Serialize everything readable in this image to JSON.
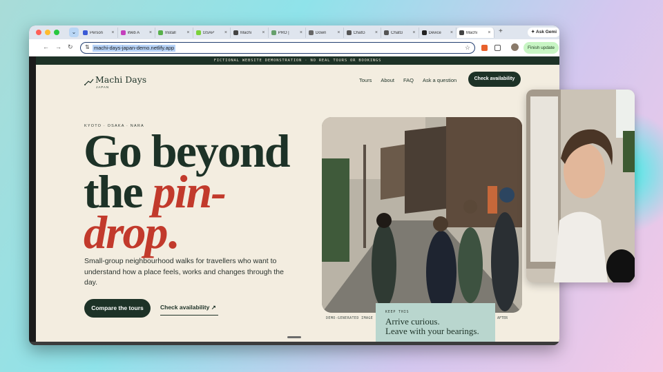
{
  "browser": {
    "tabs": [
      {
        "label": "Person",
        "favicon": "#3a5ad6",
        "active": false
      },
      {
        "label": "Web A",
        "favicon": "#c43fbd",
        "active": false
      },
      {
        "label": "Install",
        "favicon": "#58b04a",
        "active": false
      },
      {
        "label": "GSAP",
        "favicon": "#7bd13a",
        "active": false
      },
      {
        "label": "Machi",
        "favicon": "#444444",
        "active": false
      },
      {
        "label": "PRO |",
        "favicon": "#66a06c",
        "active": false
      },
      {
        "label": "Down",
        "favicon": "#666666",
        "active": false
      },
      {
        "label": "ChatG",
        "favicon": "#555555",
        "active": false
      },
      {
        "label": "ChatG",
        "favicon": "#555555",
        "active": false
      },
      {
        "label": "Device",
        "favicon": "#222222",
        "active": false
      },
      {
        "label": "Machi",
        "favicon": "#444444",
        "active": true
      }
    ],
    "tab_close": "×",
    "new_tab": "+",
    "ask_gemini": "✦ Ask Gemi",
    "url": "machi-days-japan-demo.netlify.app",
    "finish_update": "Finish update",
    "back": "←",
    "forward": "→",
    "reload": "↻",
    "star": "☆"
  },
  "page": {
    "banner": "FICTIONAL WEBSITE DEMONSTRATION  ·  NO REAL TOURS OR BOOKINGS",
    "brand": {
      "name": "Machi Days",
      "sub": "JAPAN"
    },
    "nav": [
      "Tours",
      "About",
      "FAQ",
      "Ask a question"
    ],
    "cta_top": "Check availability",
    "eyebrow": "KYOTO · OSAKA · NARA",
    "headline": {
      "l1": "Go beyond",
      "l2": "the ",
      "l2_accent": "pin-",
      "l3_accent": "drop",
      "l3_end": "."
    },
    "subcopy": "Small-group neighbourhood walks for travellers who want to understand how a place feels, works and changes through the day.",
    "btn_compare": "Compare the tours",
    "link_avail": "Check availability ↗",
    "photo_caption": "DEMO-GENERATED IMAGE",
    "photo_caption_right": "AFTER",
    "keep": {
      "label": "KEEP THIS",
      "l1": "Arrive curious.",
      "l2": "Leave with your bearings."
    }
  },
  "colors": {
    "brand_dark": "#1d3227",
    "accent_red": "#c23a2c",
    "page_bg": "#f3ede0",
    "card_teal": "#b9d6ce"
  }
}
